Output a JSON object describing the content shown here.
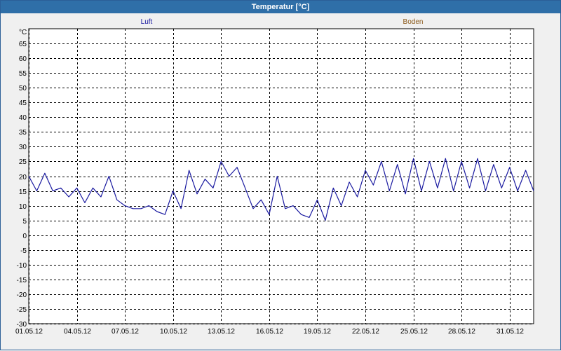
{
  "window": {
    "title": "Temperatur [°C]"
  },
  "colors": {
    "luft": "#1a1aa0",
    "boden": "#8b5a1a",
    "titlebar": "#2f6fa8"
  },
  "chart_data": {
    "type": "line",
    "title": "Temperatur [°C]",
    "ylabel": "°C",
    "xlabel": "",
    "ylim": [
      -30,
      70
    ],
    "xlim": [
      "01.05.12",
      "01.06.12 12:00"
    ],
    "grid": true,
    "legend_placement": "top",
    "x_ticks": [
      "01.05.12",
      "04.05.12",
      "07.05.12",
      "10.05.12",
      "13.05.12",
      "16.05.12",
      "19.05.12",
      "22.05.12",
      "25.05.12",
      "28.05.12",
      "31.05.12"
    ],
    "y_ticks": [
      -30,
      -25,
      -20,
      -15,
      -10,
      -5,
      0,
      5,
      10,
      15,
      20,
      25,
      30,
      35,
      40,
      45,
      50,
      55,
      60,
      65
    ],
    "series": [
      {
        "name": "Luft",
        "color": "#1a1aa0",
        "x": [
          "01.05.12 00:00",
          "01.05.12 12:00",
          "02.05.12 00:00",
          "02.05.12 12:00",
          "03.05.12 00:00",
          "03.05.12 12:00",
          "04.05.12 00:00",
          "04.05.12 12:00",
          "05.05.12 00:00",
          "05.05.12 12:00",
          "06.05.12 00:00",
          "06.05.12 12:00",
          "07.05.12 00:00",
          "07.05.12 12:00",
          "08.05.12 00:00",
          "08.05.12 12:00",
          "09.05.12 00:00",
          "09.05.12 12:00",
          "10.05.12 00:00",
          "10.05.12 12:00",
          "11.05.12 00:00",
          "11.05.12 12:00",
          "12.05.12 00:00",
          "12.05.12 12:00",
          "13.05.12 00:00",
          "13.05.12 12:00",
          "14.05.12 00:00",
          "14.05.12 12:00",
          "15.05.12 00:00",
          "15.05.12 12:00",
          "16.05.12 00:00",
          "16.05.12 12:00",
          "17.05.12 00:00",
          "17.05.12 12:00",
          "18.05.12 00:00",
          "18.05.12 12:00",
          "19.05.12 00:00",
          "19.05.12 12:00",
          "20.05.12 00:00",
          "20.05.12 12:00",
          "21.05.12 00:00",
          "21.05.12 12:00",
          "22.05.12 00:00",
          "22.05.12 12:00",
          "23.05.12 00:00",
          "23.05.12 12:00",
          "24.05.12 00:00",
          "24.05.12 12:00",
          "25.05.12 00:00",
          "25.05.12 12:00",
          "26.05.12 00:00",
          "26.05.12 12:00",
          "27.05.12 00:00",
          "27.05.12 12:00",
          "28.05.12 00:00",
          "28.05.12 12:00",
          "29.05.12 00:00",
          "29.05.12 12:00",
          "30.05.12 00:00",
          "30.05.12 12:00",
          "31.05.12 00:00",
          "31.05.12 12:00",
          "01.06.12 00:00",
          "01.06.12 12:00"
        ],
        "y": [
          20,
          15,
          21,
          15,
          16,
          13,
          16,
          11,
          16,
          13,
          20,
          12,
          10,
          9,
          9,
          10,
          8,
          7,
          15,
          9,
          22,
          14,
          19,
          16,
          25,
          20,
          23,
          16,
          9,
          12,
          7,
          20,
          9,
          10,
          7,
          6,
          12,
          5,
          16,
          10,
          18,
          13,
          22,
          17,
          25,
          15,
          24,
          14,
          26,
          15,
          25,
          16,
          26,
          15,
          25,
          16,
          26,
          15,
          24,
          16,
          23,
          15,
          22,
          15
        ]
      },
      {
        "name": "Boden",
        "color": "#8b5a1a",
        "x": [],
        "y": []
      }
    ]
  }
}
